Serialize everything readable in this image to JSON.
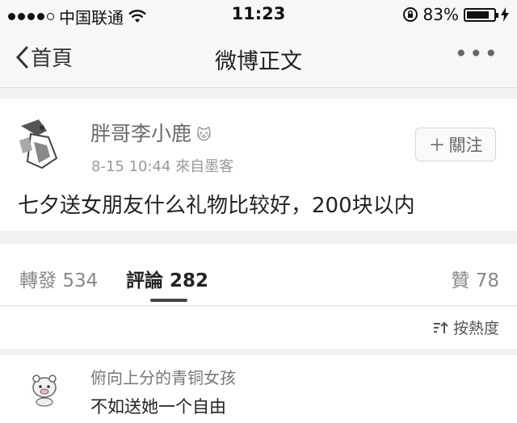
{
  "status_bar": {
    "carrier": "中国联通",
    "time": "11:23",
    "battery_percent": "83%",
    "battery_level": 0.83
  },
  "nav": {
    "back_label": "首頁",
    "title": "微博正文",
    "more_icon": "ellipsis-icon"
  },
  "post": {
    "author": "胖哥李小鹿",
    "timestamp": "8-15 10:44",
    "source": "來自墨客",
    "follow_label": "關注",
    "text": "七夕送女朋友什么礼物比较好，200块以内"
  },
  "tabs": {
    "repost_label": "轉發",
    "repost_count": "534",
    "comment_label": "評論",
    "comment_count": "282",
    "like_label": "贊",
    "like_count": "78"
  },
  "sort": {
    "label": "按熱度"
  },
  "comments": [
    {
      "user": "俯向上分的青铜女孩",
      "text": "不如送她一个自由"
    }
  ],
  "colors": {
    "background": "#f2f2f2",
    "card": "#ffffff",
    "active_tab_underline": "#444444"
  }
}
